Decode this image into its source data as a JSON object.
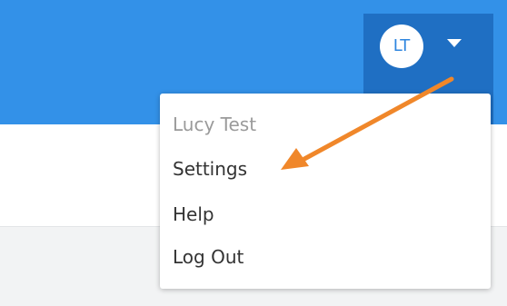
{
  "header": {
    "avatar_initials": "LT",
    "dropdown_icon": "caret-down-icon"
  },
  "menu": {
    "user_name": "Lucy Test",
    "items": [
      {
        "label": "Settings"
      },
      {
        "label": "Help"
      },
      {
        "label": "Log Out"
      }
    ]
  },
  "annotation": {
    "arrow_color": "#f0872a",
    "target": "Settings"
  },
  "colors": {
    "header": "#3391e8",
    "profile_button": "#1f6fc3",
    "menu_background": "#ffffff"
  }
}
